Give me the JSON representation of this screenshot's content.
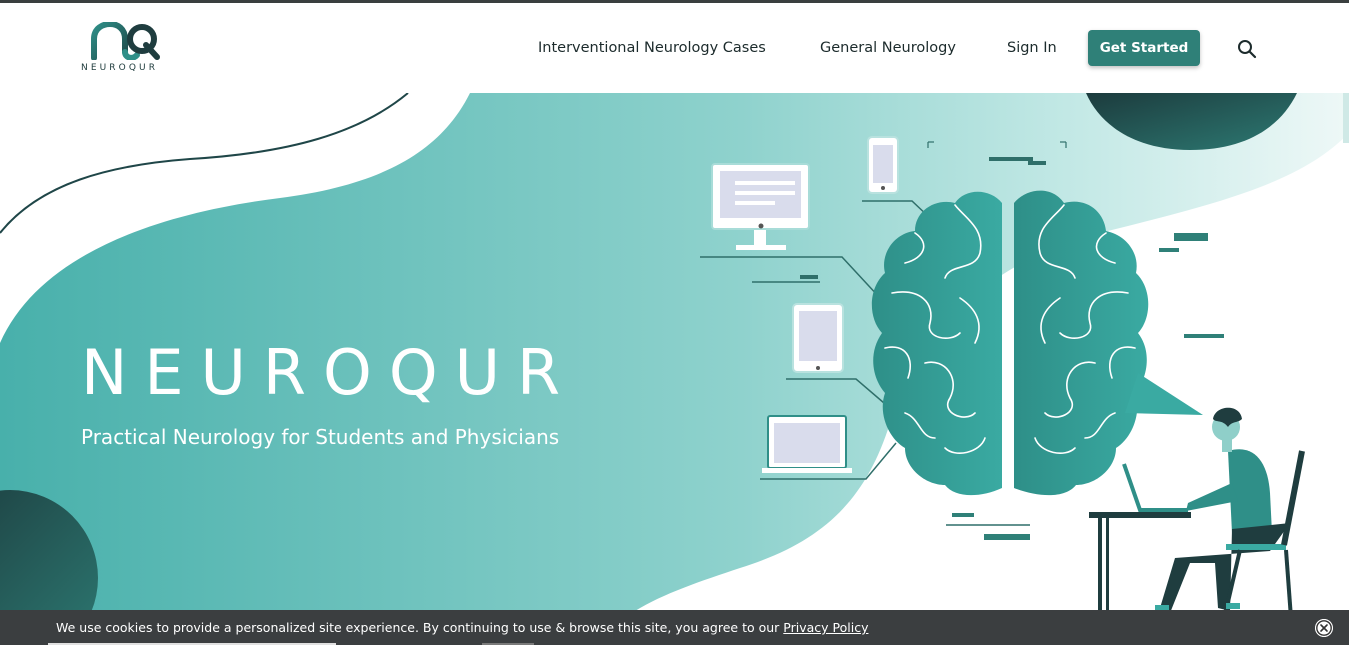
{
  "brand": {
    "logo_text": "NEUROQUR"
  },
  "nav": {
    "items": [
      {
        "label": "Interventional Neurology Cases"
      },
      {
        "label": "General Neurology"
      },
      {
        "label": "Sign In"
      }
    ],
    "cta_label": "Get Started",
    "search_icon": "search-icon"
  },
  "hero": {
    "title": "NEUROQUR",
    "subtitle": "Practical Neurology for Students and Physicians"
  },
  "cookie_banner": {
    "text": "We use cookies to provide a personalized site experience. By continuing to use & browse this site, you agree to our ",
    "link_label": "Privacy Policy",
    "close_icon": "close-icon"
  },
  "colors": {
    "accent": "#2f8078",
    "teal_light": "#9fd8d4",
    "teal_mid": "#4bb3ae",
    "dark": "#1f3d3f"
  }
}
